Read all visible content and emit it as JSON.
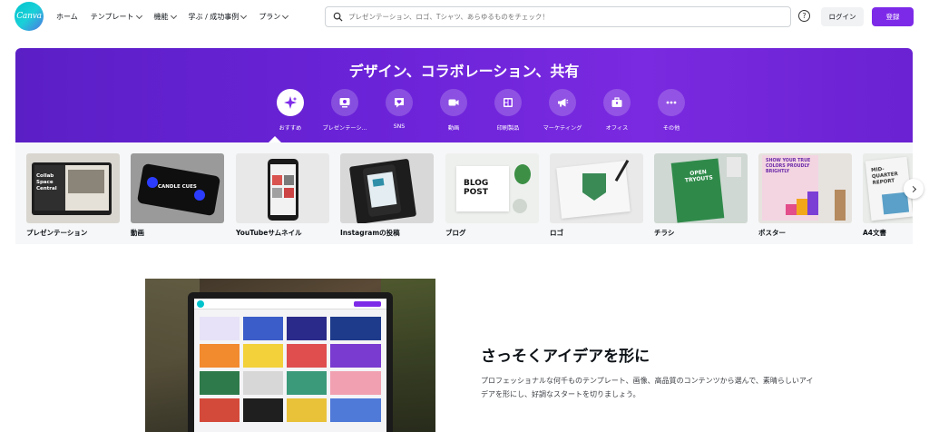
{
  "brand": {
    "logo_text": "Canva",
    "accent": "#7d2ae8",
    "teal": "#01c3cc"
  },
  "nav": {
    "items": [
      {
        "label": "ホーム",
        "dropdown": false
      },
      {
        "label": "テンプレート",
        "dropdown": true
      },
      {
        "label": "機能",
        "dropdown": true
      },
      {
        "label": "学ぶ / 成功事例",
        "dropdown": true
      },
      {
        "label": "プラン",
        "dropdown": true
      }
    ],
    "search_placeholder": "プレゼンテーション、ロゴ、Tシャツ、あらゆるものをチェック！",
    "help_icon": "?",
    "login_label": "ログイン",
    "signup_label": "登録"
  },
  "hero": {
    "title": "デザイン、コラボレーション、共有",
    "categories": [
      {
        "label": "おすすめ",
        "icon": "sparkle-icon",
        "active": true
      },
      {
        "label": "プレゼンテーシ...",
        "icon": "presentation-icon",
        "active": false
      },
      {
        "label": "SNS",
        "icon": "heart-chat-icon",
        "active": false
      },
      {
        "label": "動画",
        "icon": "video-camera-icon",
        "active": false
      },
      {
        "label": "印刷製品",
        "icon": "print-products-icon",
        "active": false
      },
      {
        "label": "マーケティング",
        "icon": "megaphone-icon",
        "active": false
      },
      {
        "label": "オフィス",
        "icon": "briefcase-icon",
        "active": false
      },
      {
        "label": "その他",
        "icon": "more-icon",
        "active": false
      }
    ]
  },
  "templates": [
    {
      "label": "プレゼンテーション",
      "thumb_text": "Collab Space Central"
    },
    {
      "label": "動画",
      "thumb_text": "CANDLE CUES"
    },
    {
      "label": "YouTubeサムネイル",
      "thumb_text": ""
    },
    {
      "label": "Instagramの投稿",
      "thumb_text": ""
    },
    {
      "label": "ブログ",
      "thumb_text": "BLOG POST"
    },
    {
      "label": "ロゴ",
      "thumb_text": ""
    },
    {
      "label": "チラシ",
      "thumb_text": "OPEN TRYOUTS"
    },
    {
      "label": "ポスター",
      "thumb_text": "SHOW YOUR TRUE COLORS PROUDLY BRIGHTLY"
    },
    {
      "label": "A4文書",
      "thumb_text": "MID-QUARTER REPORT"
    }
  ],
  "feature": {
    "title": "さっそくアイデアを形に",
    "description": "プロフェッショナルな何千ものテンプレート、画像、高品質のコンテンツから選んで、素晴らしいアイデアを形にし、好調なスタートを切りましょう。"
  }
}
